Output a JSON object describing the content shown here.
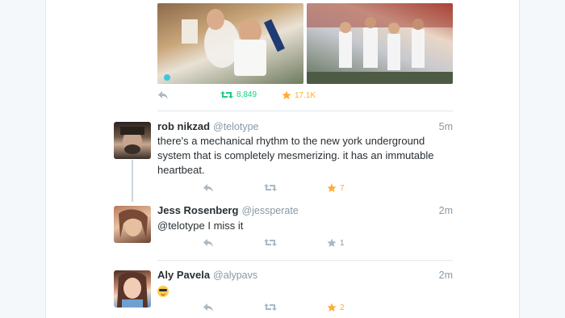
{
  "tweets": [
    {
      "retweets": "8,849",
      "favorites": "17.1K"
    },
    {
      "name": "rob nikzad",
      "handle": "@telotype",
      "time": "5m",
      "text": "there's a mechanical rhythm to the new york underground system that is completely mesmerizing. it has an immutable heartbeat.",
      "retweets": "",
      "favorites": "7"
    },
    {
      "name": "Jess Rosenberg",
      "handle": "@jessperate",
      "time": "2m",
      "text": "@telotype I miss it",
      "retweets": "",
      "favorites": "1"
    },
    {
      "name": "Aly Pavela",
      "handle": "@alypavs",
      "time": "2m",
      "text": "",
      "emoji": "sunglasses-emoji",
      "retweets": "",
      "favorites": "2"
    }
  ],
  "icons": {
    "reply": "reply-icon",
    "retweet": "retweet-icon",
    "favorite": "star-icon"
  },
  "colors": {
    "retweet_active": "#19cf86",
    "favorite_active": "#ffac33",
    "muted": "#8899a6",
    "text": "#292f33"
  }
}
